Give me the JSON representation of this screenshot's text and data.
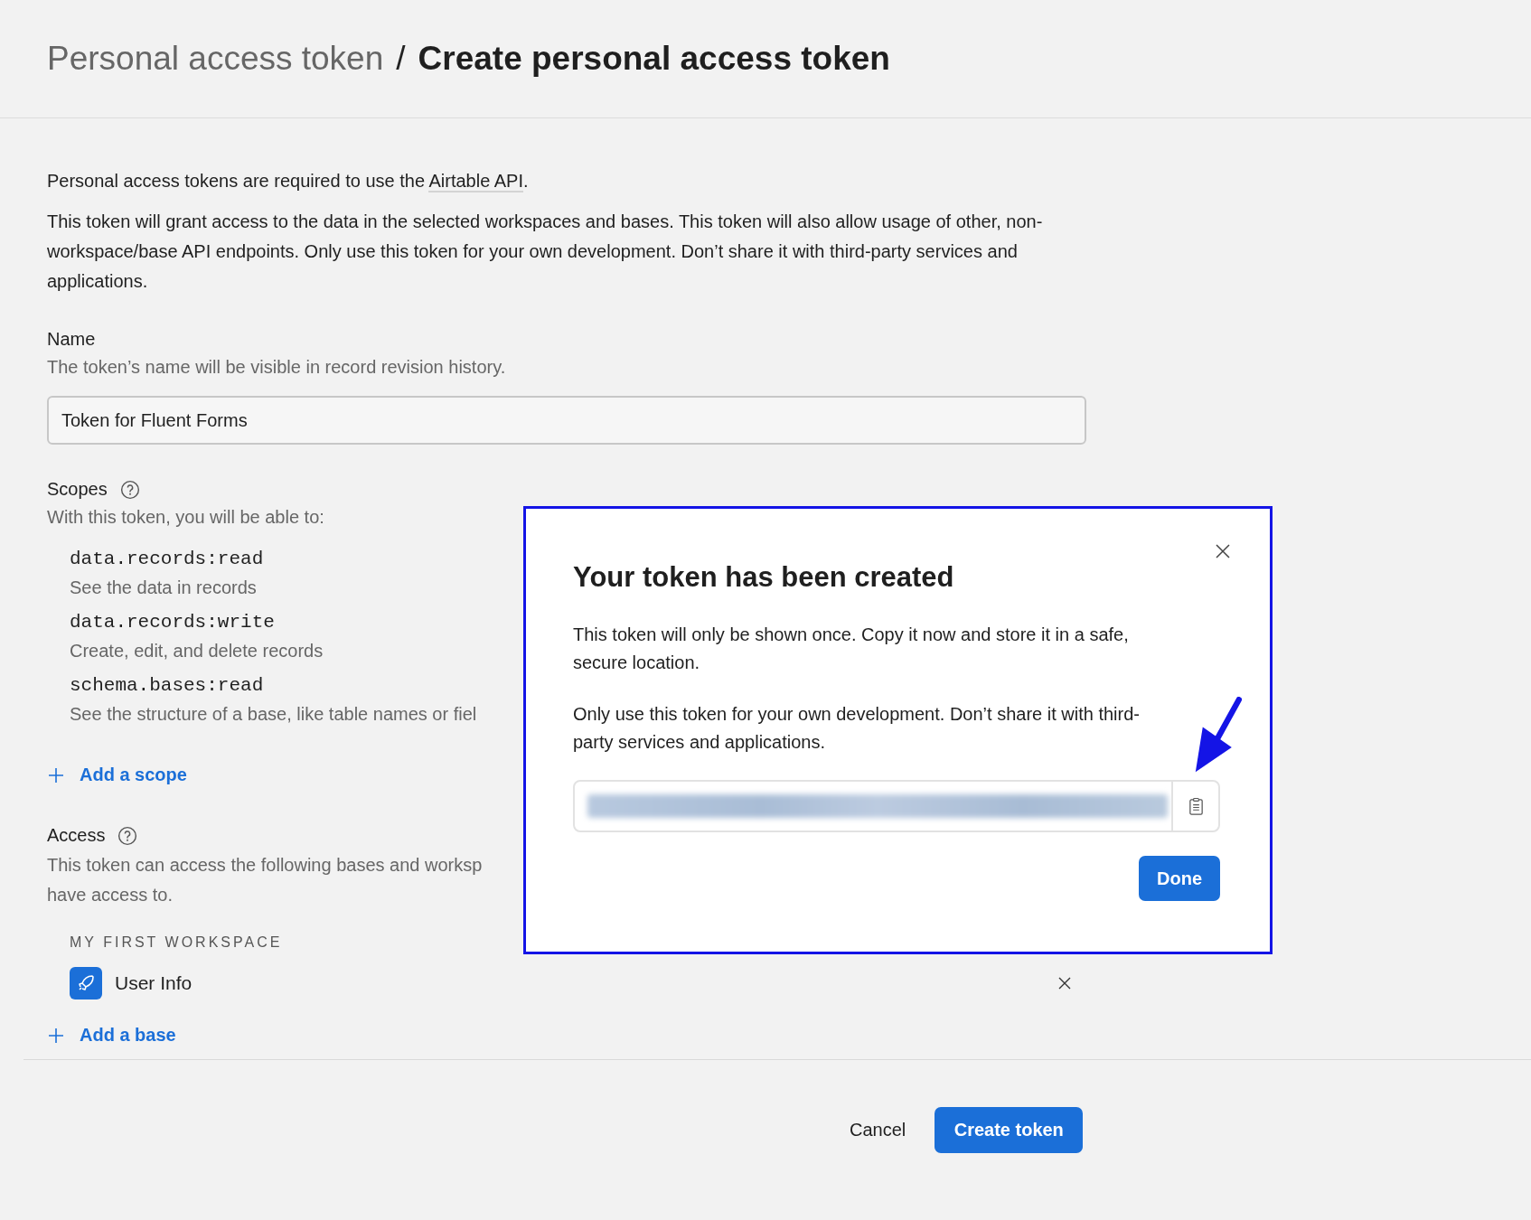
{
  "breadcrumb": {
    "parent": "Personal access token",
    "separator": "/",
    "current": "Create personal access token"
  },
  "intro": {
    "before": "Personal access tokens are required to use the ",
    "link": "Airtable API",
    "after": "."
  },
  "description": "This token will grant access to the data in the selected workspaces and bases. This token will also allow usage of other, non-workspace/base API endpoints. Only use this token for your own development. Don’t share it with third-party services and applications.",
  "name_field": {
    "label": "Name",
    "hint": "The token’s name will be visible in record revision history.",
    "value": "Token for Fluent Forms"
  },
  "scopes": {
    "label": "Scopes",
    "hint": "With this token, you will be able to:",
    "items": [
      {
        "scope": "data.records:read",
        "description": "See the data in records"
      },
      {
        "scope": "data.records:write",
        "description": "Create, edit, and delete records"
      },
      {
        "scope": "schema.bases:read",
        "description": "See the structure of a base, like table names or fiel"
      }
    ],
    "add_button": "Add a scope"
  },
  "access": {
    "label": "Access",
    "hint_lines": [
      "This token can access the following bases and worksp",
      "have access to."
    ],
    "workspace": "MY FIRST WORKSPACE",
    "bases": [
      {
        "name": "User Info"
      }
    ],
    "add_button": "Add a base"
  },
  "footer": {
    "cancel": "Cancel",
    "submit": "Create token"
  },
  "dialog": {
    "title": "Your token has been created",
    "paragraphs": [
      "This token will only be shown once. Copy it now and store it in a safe, secure location.",
      "Only use this token for your own development. Don’t share it with third-party services and applications."
    ],
    "done": "Done"
  }
}
